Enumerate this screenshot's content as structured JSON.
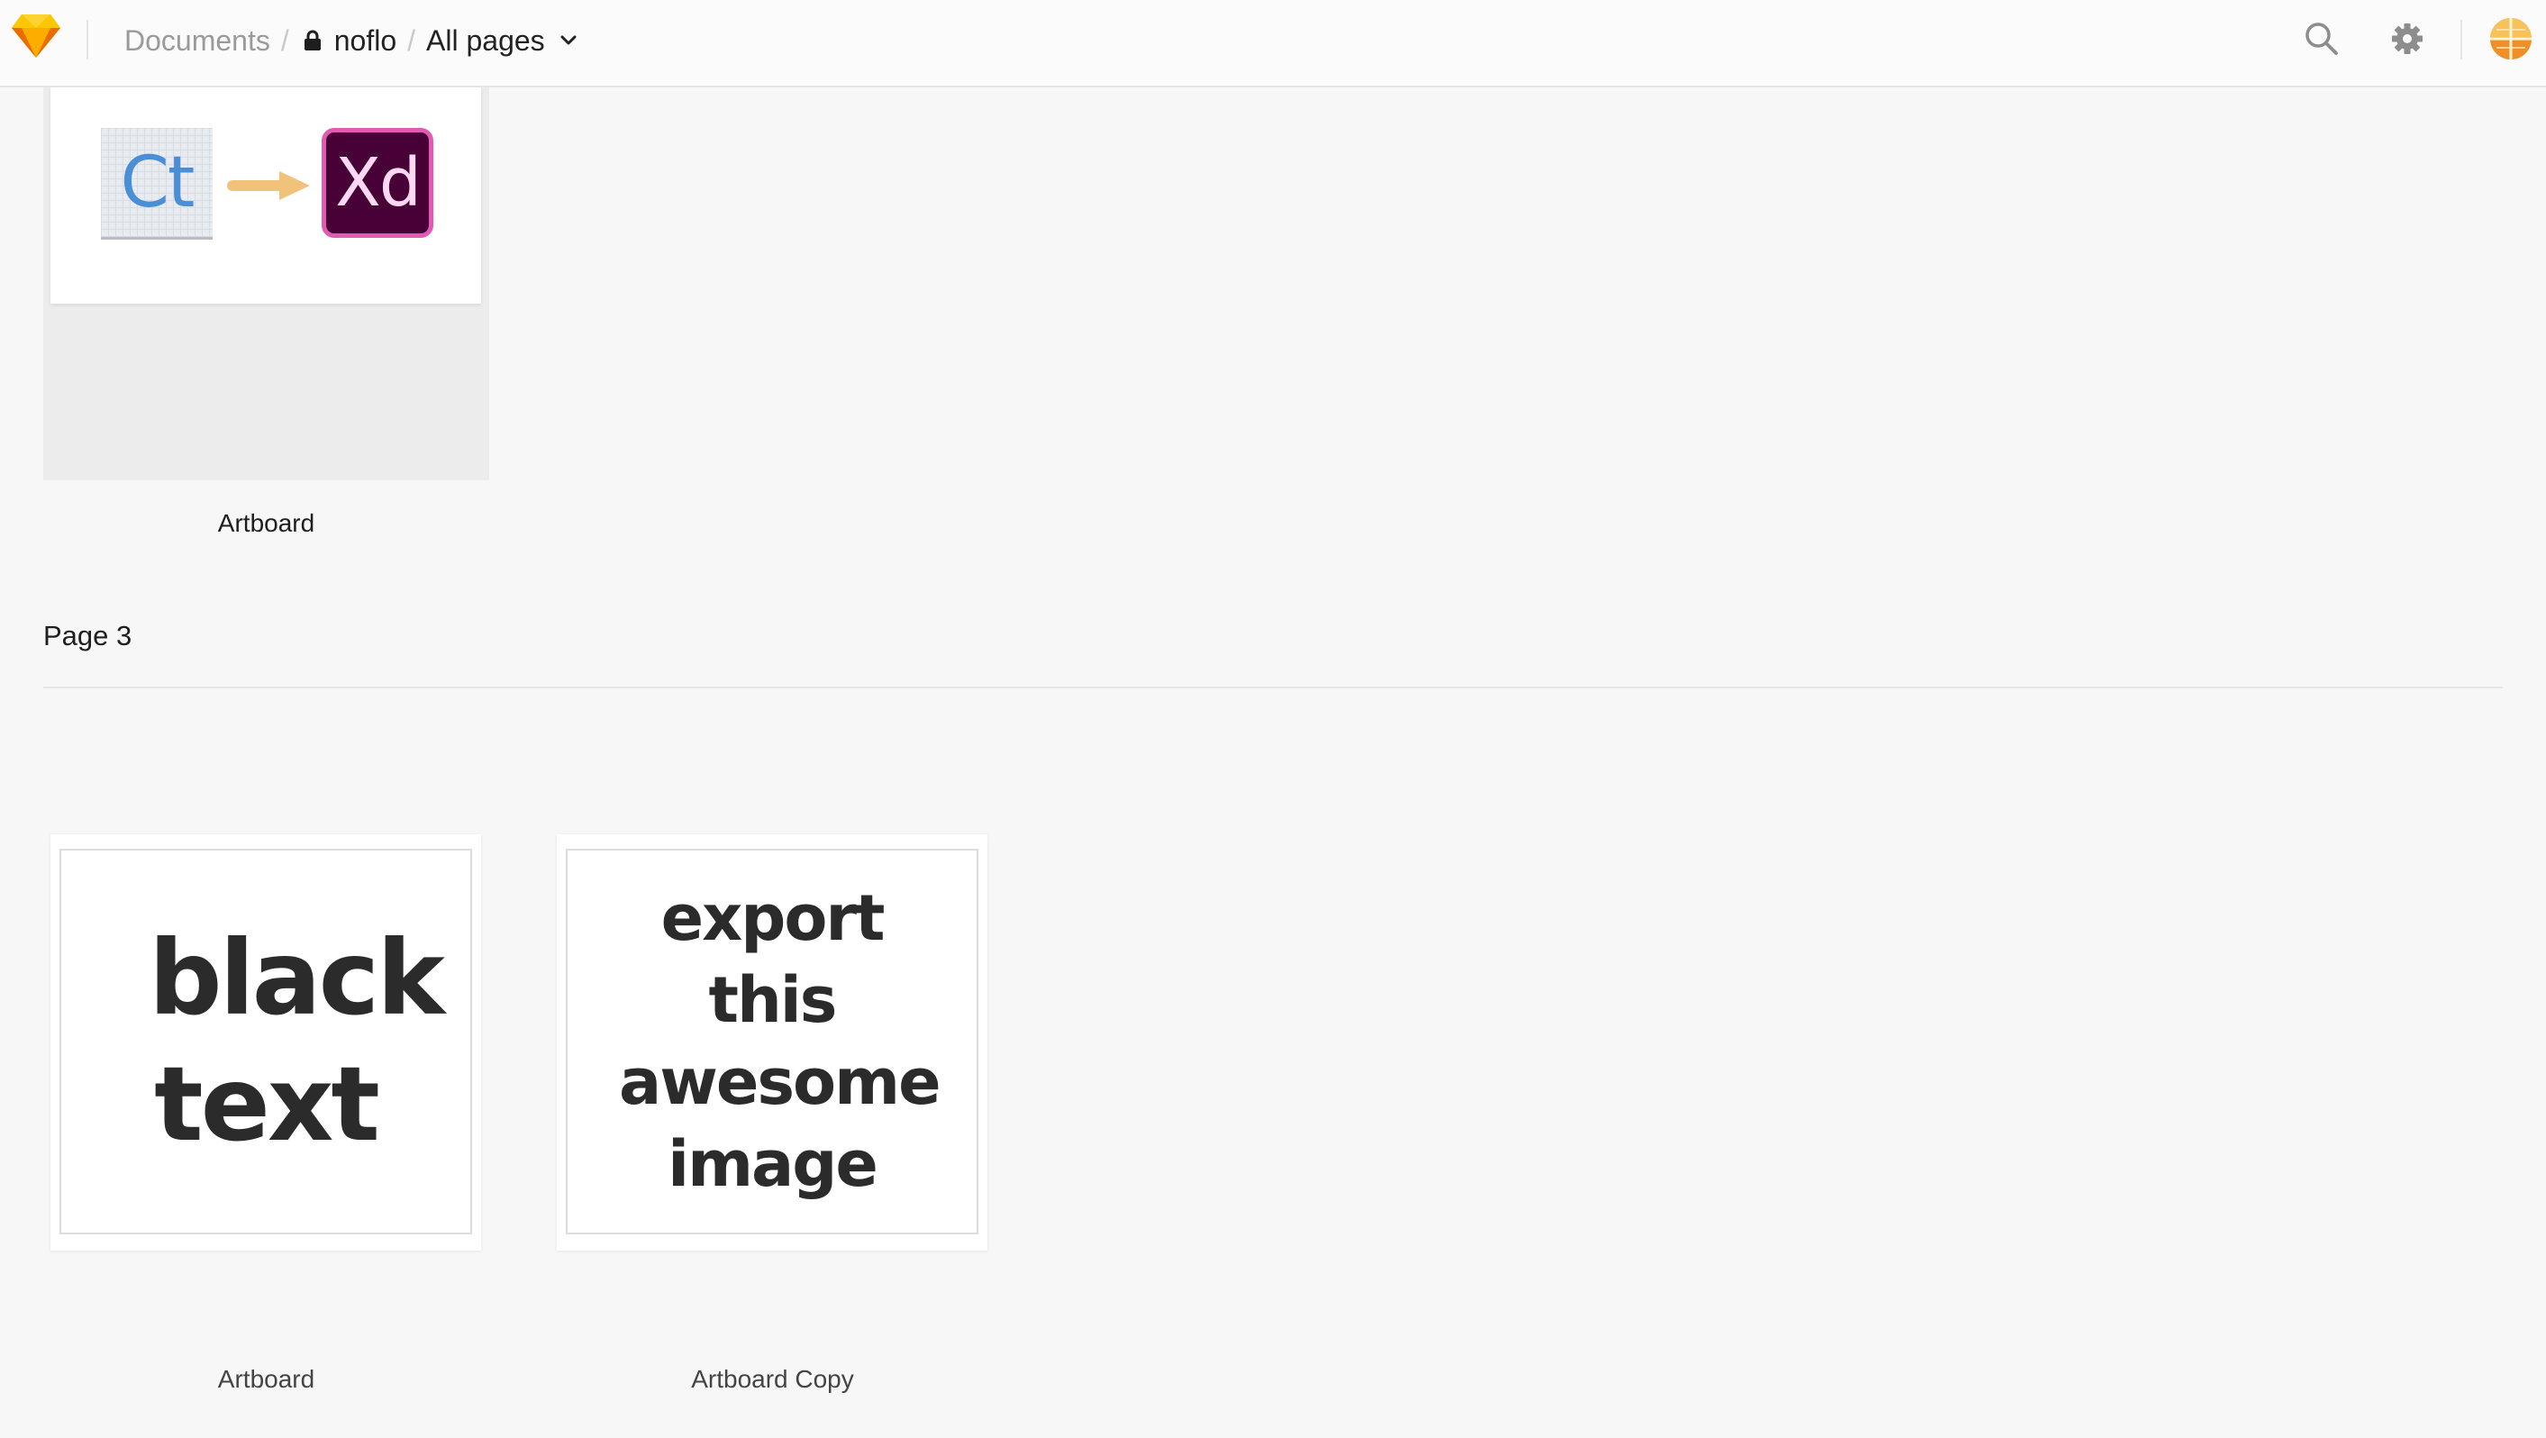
{
  "topbar": {
    "breadcrumb": {
      "documents": "Documents",
      "project": "noflo",
      "pages_selector": "All pages"
    }
  },
  "pages": [
    {
      "artboards": [
        {
          "name": "Artboard",
          "preview_left_logo": "Ct",
          "preview_right_logo": "Xd"
        }
      ]
    },
    {
      "title": "Page 3",
      "artboards": [
        {
          "name": "Artboard",
          "preview_text": "black text"
        },
        {
          "name": "Artboard Copy",
          "preview_text": "export this awesome image"
        }
      ]
    }
  ],
  "colors": {
    "sketch_brand": "#f7b500",
    "background": "#f7f7f7",
    "xd_bg": "#470137",
    "xd_border": "#e25ab2",
    "ct_text": "#4a8fd6",
    "arrow": "#f0c27a"
  },
  "icons": {
    "logo": "sketch-diamond-icon",
    "lock": "lock-icon",
    "chevron": "chevron-down-icon",
    "search": "search-icon",
    "settings": "gear-icon",
    "avatar": "globe-avatar"
  }
}
